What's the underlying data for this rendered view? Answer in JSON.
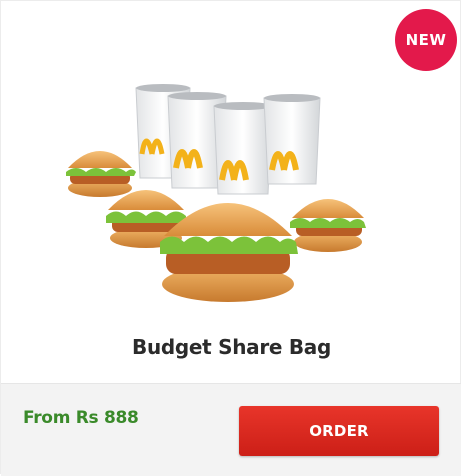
{
  "card": {
    "badge": "NEW",
    "title": "Budget Share Bag",
    "price_label": "From Rs 888",
    "order_label": "ORDER"
  },
  "colors": {
    "badge": "#e3194b",
    "price": "#3a8a2a",
    "order_button": "#dd2b21",
    "title": "#2b2b2b"
  },
  "image": {
    "items": [
      "drink-cup",
      "drink-cup",
      "drink-cup",
      "drink-cup",
      "burger",
      "burger",
      "burger",
      "burger"
    ]
  }
}
